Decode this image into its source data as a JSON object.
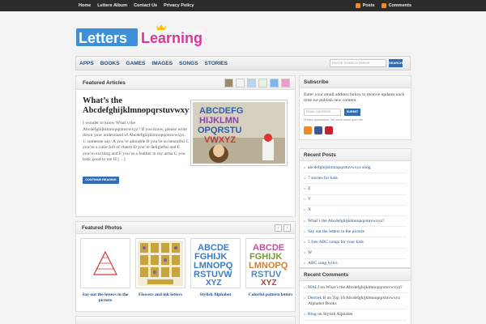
{
  "topbar": {
    "nav": [
      "Home",
      "Letters Album",
      "Contact Us",
      "Privacy Policy"
    ],
    "feeds": [
      {
        "label": "Posts",
        "icon": "rss-icon"
      },
      {
        "label": "Comments",
        "icon": "rss-icon"
      }
    ]
  },
  "logo": {
    "text_a": "Letters",
    "text_b": "Learning"
  },
  "mainnav": {
    "items": [
      "APPS",
      "BOOKS",
      "GAMES",
      "IMAGES",
      "SONGS",
      "STORIES"
    ],
    "search_placeholder": "ENTER SEARCH TERMS",
    "search_button": "SEARCH"
  },
  "featured": {
    "heading": "Featured Articles",
    "title_line1": "What’s the",
    "title_line2": "Abcdefghijklmnopqrstuvwxyz",
    "excerpt": "I wonder to know What’s the Abcdefghijklmnopqrstuvwxyz? If you know, please write down your understand of Abcdefghijklmnopqrstuvwxyz. 1. someone say: A you’re adorable B you’re so beautiful C you’re a cutie full of charm D you’re delightful and E you’re exciting and F you’re a feather in my arms G you look good to me H […]",
    "read_more": "CONTINUE READING",
    "image_letters": [
      "ABCDEFG",
      "HIJKLMN",
      "OPQRSTU",
      "VWXYZ"
    ]
  },
  "photos": {
    "heading": "Featured Photos",
    "prev": "‹",
    "next": "›",
    "items": [
      {
        "caption": "Say out the letters in the picture"
      },
      {
        "caption": "Flowers and ink letters"
      },
      {
        "caption": "Stylish Alphabet",
        "rows": [
          "ABCDE",
          "FGHIJK",
          "LMNOPQ",
          "RSTUVW",
          "XYZ"
        ]
      },
      {
        "caption": "Colorful pattern letters",
        "rows": [
          "ABCDE",
          "FGHIJK",
          "LMNOPQ",
          "RSTUV",
          "XYZ"
        ]
      }
    ]
  },
  "subscribe": {
    "heading": "Subscribe",
    "text": "Enter your email address below to receive updates each time we publish new content.",
    "email_placeholder": "EMAIL ADDRESS",
    "button": "SUBMIT",
    "privacy": "Privacy guaranteed. We never share your info."
  },
  "recent_posts": {
    "heading": "Recent Posts",
    "items": [
      "abcdefghijklmnopqrstuvwxyz song",
      "7 stories for kids",
      "Z",
      "Y",
      "X",
      "What’s the Abcdefghijklmnopqrstuvwxyz?",
      "Say out the letters in the picture",
      "5 free ABC songs for your kids",
      "W",
      "ABC song lyrics"
    ]
  },
  "recent_comments": {
    "heading": "Recent Comments",
    "items": [
      {
        "author": "MALI",
        "rest": "on What’s the Abcdefghijklmnopqrstuvwxyz?"
      },
      {
        "author": "Derrrek B",
        "rest": "on Top 10 Abcdefghijklmnopqrstuvwxyz Alphabet Books"
      },
      {
        "author": "Bing",
        "rest": "on Stylish Alphabet"
      }
    ]
  },
  "colors": {
    "accent": "#2f6db5",
    "link": "#1d4e86",
    "rss": "#f08a24",
    "topbar": "#2b2b2b"
  }
}
